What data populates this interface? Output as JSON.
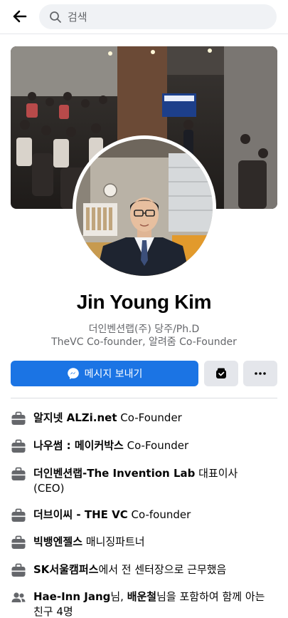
{
  "search": {
    "placeholder": "검색"
  },
  "profile": {
    "name": "Jin Young Kim",
    "bio_line1": "더인벤션랩(주) 당주/Ph.D",
    "bio_line2": "TheVC Co-founder, 알려줌 Co-Founder"
  },
  "actions": {
    "message_label": "메시지 보내기"
  },
  "intro": [
    {
      "bold": "알지넷 ALZi.net",
      "rest": " Co-Founder",
      "icon": "briefcase-icon"
    },
    {
      "bold": "나우썸 : 메이커박스",
      "rest": " Co-Founder",
      "icon": "briefcase-icon"
    },
    {
      "bold": "더인벤션랩-The Invention Lab",
      "rest": " 대표이사 (CEO)",
      "icon": "briefcase-icon"
    },
    {
      "bold": "더브이씨 - THE VC",
      "rest": " Co-founder",
      "icon": "briefcase-icon"
    },
    {
      "bold": "빅뱅엔젤스",
      "rest": " 매니징파트너",
      "icon": "briefcase-icon"
    },
    {
      "bold": "SK서울캠퍼스",
      "rest": "에서 전 센터장으로 근무했음",
      "icon": "briefcase-icon"
    }
  ],
  "mutual": {
    "name1": "Hae-Inn Jang",
    "mid": "님, ",
    "name2": "배운철",
    "rest": "님을 포함하여 함께 아는 친구 4명"
  },
  "colors": {
    "accent": "#1b74e4",
    "secondary_text": "#65676b"
  }
}
